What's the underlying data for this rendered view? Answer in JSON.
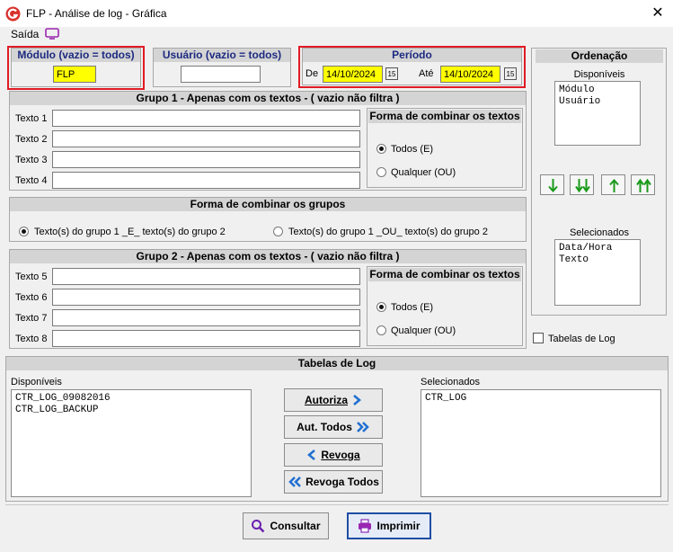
{
  "window": {
    "title": "FLP - Análise de log - Gráfica",
    "close_glyph": "✕"
  },
  "menu": {
    "saida": "Saída",
    "saida_icon": "monitor-icon"
  },
  "modulo": {
    "header": "Módulo (vazio = todos)",
    "value": "FLP"
  },
  "usuario": {
    "header": "Usuário (vazio = todos)",
    "value": ""
  },
  "periodo": {
    "header": "Período",
    "de_label": "De",
    "de_value": "14/10/2024",
    "ate_label": "Até",
    "ate_value": "14/10/2024",
    "calendar_glyph": "15"
  },
  "ordenacao": {
    "header": "Ordenação",
    "disponiveis_label": "Disponíveis",
    "disponiveis": [
      "Módulo",
      "Usuário"
    ],
    "selecionados_label": "Selecionados",
    "selecionados": [
      "Data/Hora",
      "Texto"
    ],
    "tabelas_de_log_checkbox": "Tabelas de Log"
  },
  "grupo1": {
    "header": "Grupo 1 - Apenas com os textos - ( vazio não filtra )",
    "fields": [
      {
        "label": "Texto 1",
        "value": ""
      },
      {
        "label": "Texto 2",
        "value": ""
      },
      {
        "label": "Texto 3",
        "value": ""
      },
      {
        "label": "Texto 4",
        "value": ""
      }
    ],
    "combine_header": "Forma de combinar os textos",
    "option_todos": "Todos (E)",
    "option_qualquer": "Qualquer (OU)"
  },
  "combinar_grupos": {
    "header": "Forma de combinar os grupos",
    "option_e": "Texto(s) do grupo 1 _E_ texto(s) do grupo 2",
    "option_ou": "Texto(s) do grupo 1 _OU_ texto(s) do grupo 2"
  },
  "grupo2": {
    "header": "Grupo 2 - Apenas com os textos - ( vazio não filtra )",
    "fields": [
      {
        "label": "Texto 5",
        "value": ""
      },
      {
        "label": "Texto 6",
        "value": ""
      },
      {
        "label": "Texto 7",
        "value": ""
      },
      {
        "label": "Texto 8",
        "value": ""
      }
    ],
    "combine_header": "Forma de combinar os textos",
    "option_todos": "Todos (E)",
    "option_qualquer": "Qualquer (OU)"
  },
  "tabelas_log": {
    "header": "Tabelas de Log",
    "disponiveis_label": "Disponíveis",
    "disponiveis": [
      "CTR_LOG_09082016",
      "CTR_LOG_BACKUP"
    ],
    "selecionados_label": "Selecionados",
    "selecionados": [
      "CTR_LOG"
    ],
    "btn_autoriza": "Autoriza",
    "btn_aut_todos": "Aut. Todos",
    "btn_revoga": "Revoga",
    "btn_revoga_todos": "Revoga Todos"
  },
  "footer": {
    "btn_consultar": "Consultar",
    "btn_imprimir": "Imprimir"
  },
  "colors": {
    "accent_blue": "#1c2a80",
    "highlight_red": "#e01b24",
    "field_yellow": "#ffff00",
    "arrow_green": "#1a9a1a",
    "button_border": "#1f4ea3"
  }
}
